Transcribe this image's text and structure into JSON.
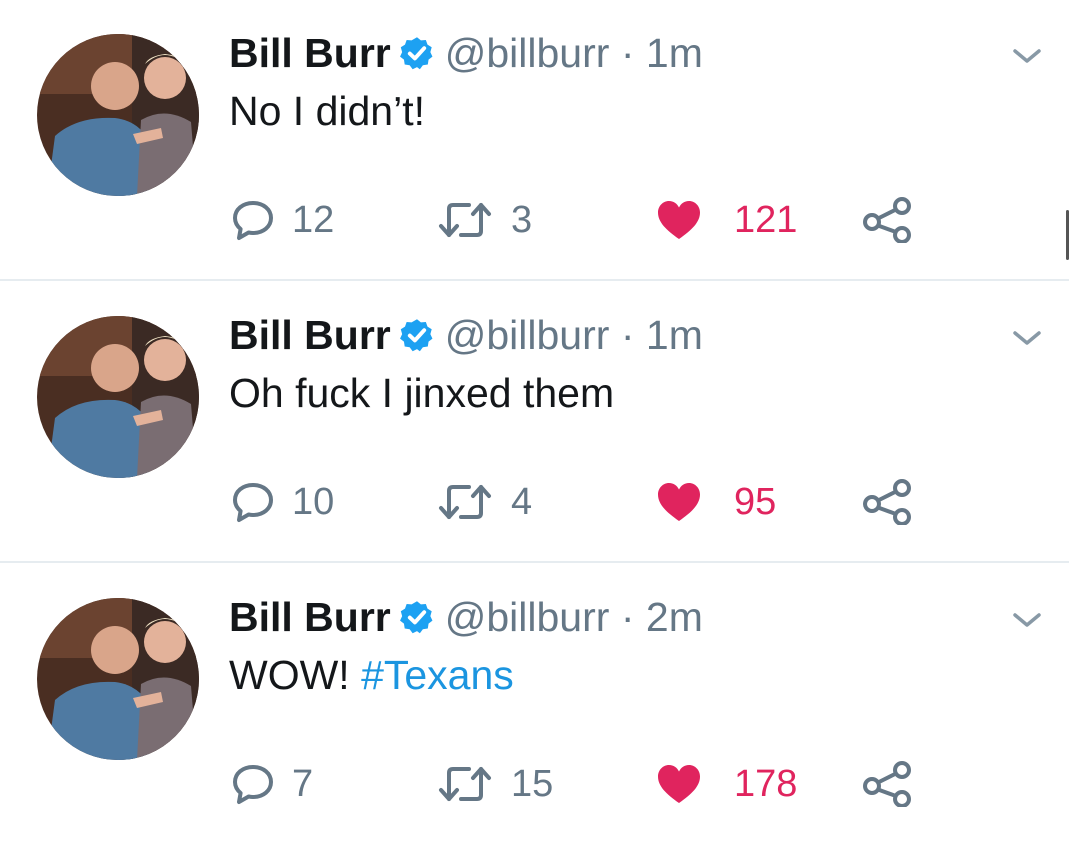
{
  "colors": {
    "text": "#14171a",
    "secondary": "#657786",
    "verified": "#1da1f2",
    "hashtag": "#1b95e0",
    "like": "#e0245e",
    "divider": "#e6ecf0"
  },
  "icons": {
    "verified": "verified-badge-icon",
    "caret": "chevron-down-icon",
    "reply": "reply-icon",
    "retweet": "retweet-icon",
    "like": "heart-icon",
    "share": "share-icon"
  },
  "tweets": [
    {
      "name": "Bill Burr",
      "handle": "@billburr",
      "dot": "·",
      "time": "1m",
      "text": "No I didn’t!",
      "hashtag": "",
      "replies": "12",
      "retweets": "3",
      "likes": "121",
      "liked": true
    },
    {
      "name": "Bill Burr",
      "handle": "@billburr",
      "dot": "·",
      "time": "1m",
      "text": "Oh fuck I jinxed them",
      "hashtag": "",
      "replies": "10",
      "retweets": "4",
      "likes": "95",
      "liked": true
    },
    {
      "name": "Bill Burr",
      "handle": "@billburr",
      "dot": "·",
      "time": "2m",
      "text": "WOW! ",
      "hashtag": "#Texans",
      "replies": "7",
      "retweets": "15",
      "likes": "178",
      "liked": true
    }
  ]
}
